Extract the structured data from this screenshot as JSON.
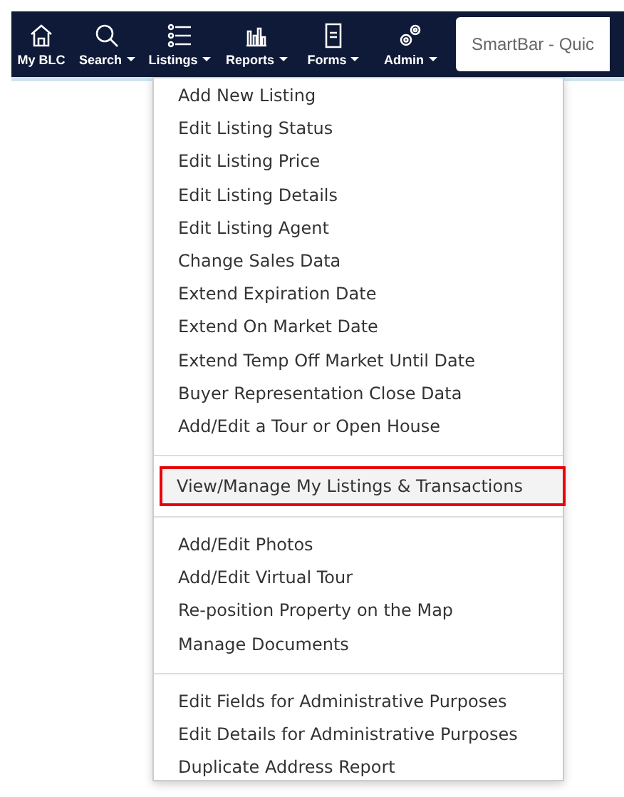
{
  "nav": [
    {
      "label": "My BLC",
      "caret": false
    },
    {
      "label": "Search",
      "caret": true
    },
    {
      "label": "Listings",
      "caret": true
    },
    {
      "label": "Reports",
      "caret": true
    },
    {
      "label": "Forms",
      "caret": true
    },
    {
      "label": "Admin",
      "caret": true
    }
  ],
  "smartbar": {
    "placeholder": "SmartBar - Quic"
  },
  "menu": [
    [
      {
        "label": "Add New Listing",
        "highlighted": false
      },
      {
        "label": "Edit Listing Status",
        "highlighted": false
      },
      {
        "label": "Edit Listing Price",
        "highlighted": false
      },
      {
        "label": "Edit Listing Details",
        "highlighted": false
      },
      {
        "label": "Edit Listing Agent",
        "highlighted": false
      },
      {
        "label": "Change Sales Data",
        "highlighted": false
      },
      {
        "label": "Extend Expiration Date",
        "highlighted": false
      },
      {
        "label": "Extend On Market Date",
        "highlighted": false
      },
      {
        "label": "Extend Temp Off Market Until Date",
        "highlighted": false
      },
      {
        "label": "Buyer Representation Close Data",
        "highlighted": false
      },
      {
        "label": "Add/Edit a Tour or Open House",
        "highlighted": false
      }
    ],
    [
      {
        "label": "View/Manage My Listings & Transactions",
        "highlighted": true
      }
    ],
    [
      {
        "label": "Add/Edit Photos",
        "highlighted": false
      },
      {
        "label": "Add/Edit Virtual Tour",
        "highlighted": false
      },
      {
        "label": "Re-position Property on the Map",
        "highlighted": false
      },
      {
        "label": "Manage Documents",
        "highlighted": false
      }
    ],
    [
      {
        "label": "Edit Fields for Administrative Purposes",
        "highlighted": false
      },
      {
        "label": "Edit Details for Administrative Purposes",
        "highlighted": false
      },
      {
        "label": "Duplicate Address Report",
        "highlighted": false
      }
    ]
  ]
}
